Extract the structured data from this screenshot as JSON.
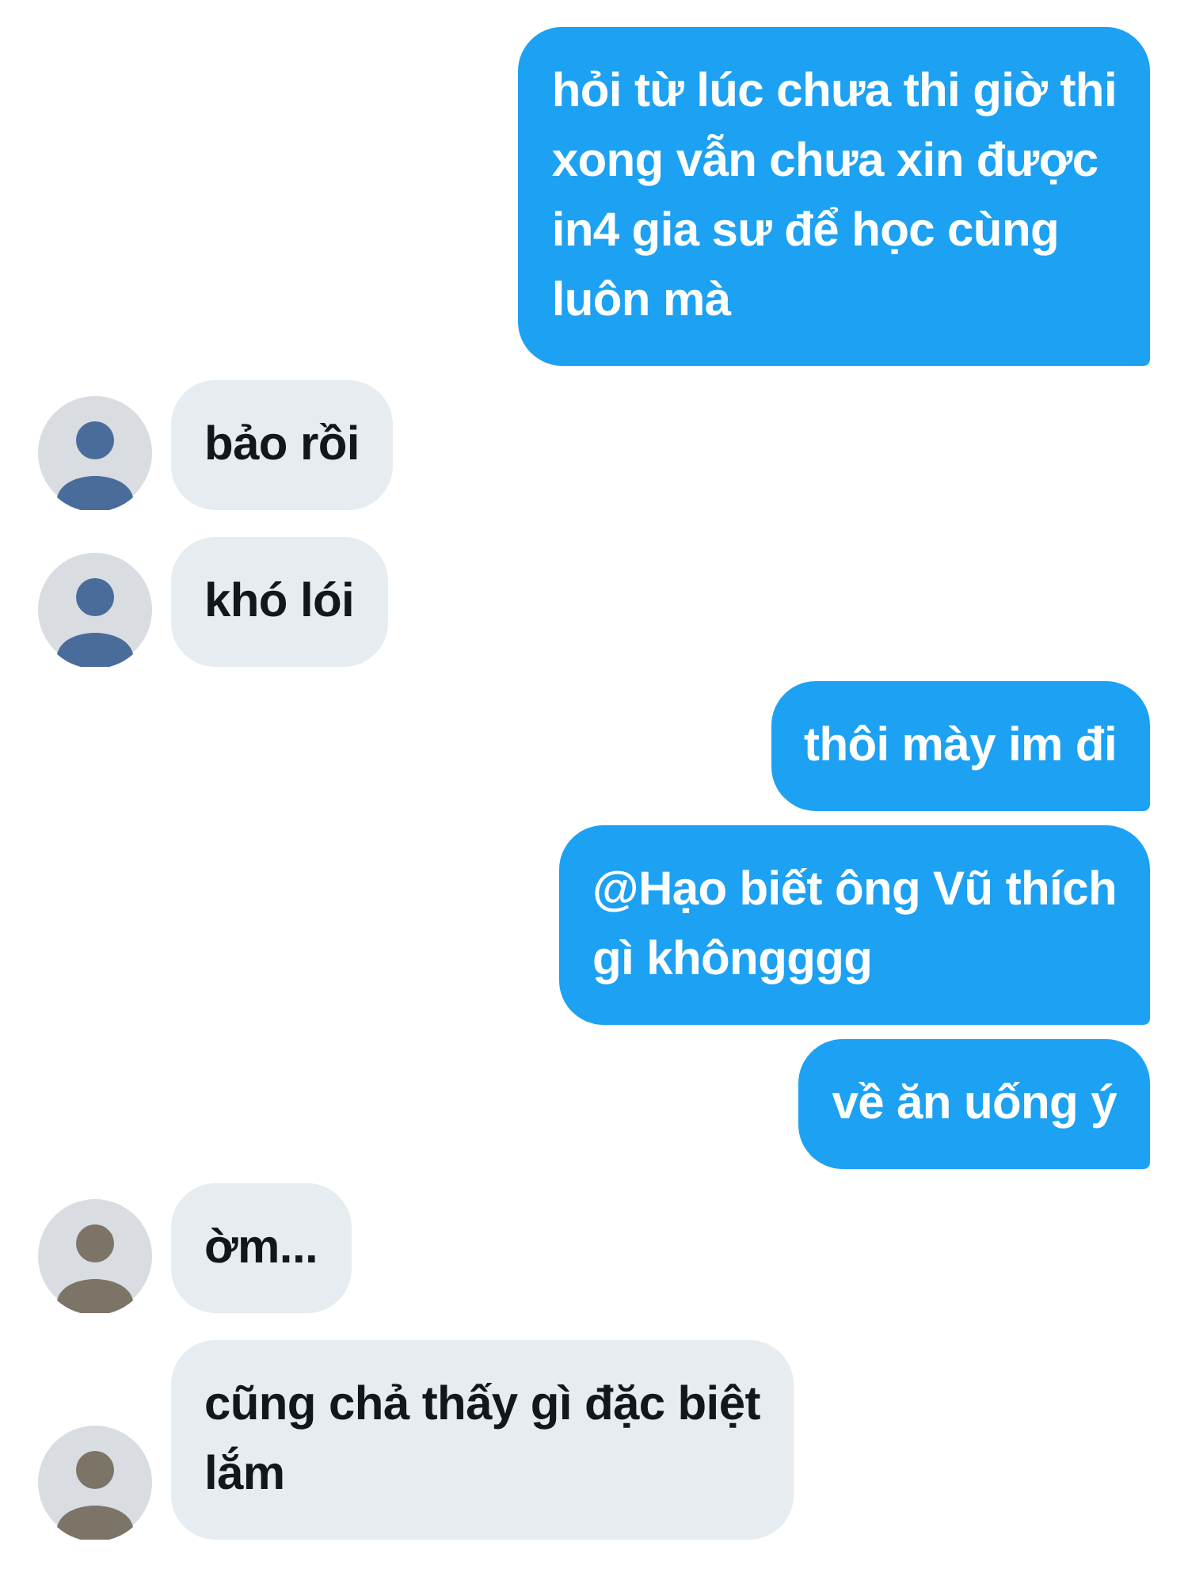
{
  "messages": [
    {
      "kind": "outgoing",
      "lines": [
        "hỏi từ lúc chưa thi giờ thi",
        "xong vẫn chưa xin được",
        "in4 gia sư để học cùng",
        "luôn mà"
      ]
    },
    {
      "kind": "incoming",
      "color": "#4a6c9b",
      "lines": [
        "bảo rồi"
      ]
    },
    {
      "kind": "incoming",
      "color": "#4a6c9b",
      "lines": [
        "khó lói"
      ]
    },
    {
      "kind": "outgoing",
      "lines": [
        "thôi mày im đi"
      ]
    },
    {
      "kind": "outgoing",
      "lines": [
        "@Hạo biết ông Vũ thích",
        "gì khôngggg"
      ]
    },
    {
      "kind": "outgoing",
      "lines": [
        "về ăn uống ý"
      ]
    },
    {
      "kind": "incoming",
      "color": "#7d7468",
      "lines": [
        "ờm..."
      ]
    },
    {
      "kind": "incoming",
      "color": "#7d7468",
      "lines": [
        "cũng chả thấy gì đặc biệt",
        "lắm"
      ]
    }
  ]
}
